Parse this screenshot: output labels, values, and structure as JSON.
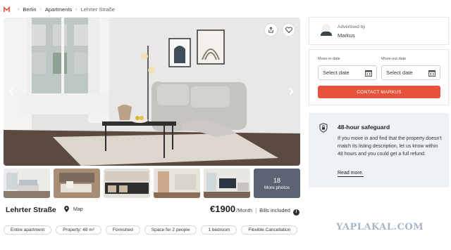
{
  "breadcrumb": {
    "items": [
      "Berlin",
      "Apartments"
    ],
    "current": "Lehrter Straße"
  },
  "thumbnails": {
    "more_count": "18",
    "more_label": "More photos"
  },
  "listing": {
    "title": "Lehrter Straße",
    "map_label": "Map",
    "price": "€1900",
    "period": "/Month",
    "separator": "|",
    "bills": "Bills included",
    "info_glyph": "i"
  },
  "tags": [
    "Entire apartment",
    "Property: 48 m²",
    "Furnished",
    "Space for 2 people",
    "1 bedroom",
    "Flexible Cancellation"
  ],
  "advertiser": {
    "label": "Advertised by",
    "name": "Markus"
  },
  "booking": {
    "move_in_label": "Move-in date",
    "move_in_placeholder": "Select date",
    "move_out_label": "Move-out date",
    "move_out_placeholder": "Select date",
    "contact_label": "CONTACT MARKUS"
  },
  "safeguard": {
    "title": "48-hour safeguard",
    "body": "If you move in and find that the property doesn't match its listing description, let us know within 48 hours and you could get a full refund.",
    "read_more": "Read more."
  },
  "watermark": "YAPLAKAL.COM",
  "colors": {
    "accent": "#e8523a",
    "safeguard_bg": "#eef1f5",
    "breadcrumb_logo": "#e8523a"
  },
  "icons": [
    "logo-icon",
    "chevron-right-icon",
    "share-icon",
    "heart-icon",
    "chevron-left-icon",
    "map-pin-icon",
    "info-icon",
    "avatar-icon",
    "calendar-icon",
    "shield-icon"
  ]
}
